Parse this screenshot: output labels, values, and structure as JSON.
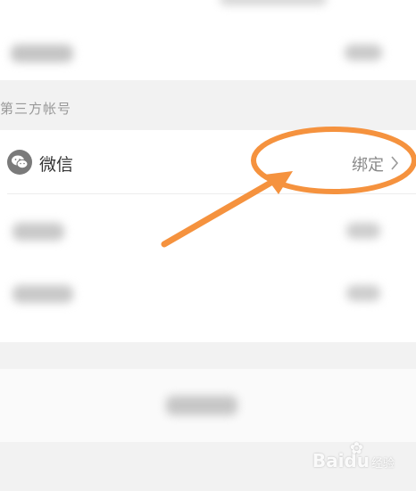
{
  "section": {
    "third_party_accounts": "第三方帐号"
  },
  "wechat_row": {
    "icon": "wechat-icon",
    "label": "微信",
    "action": "绑定",
    "chevron": "chevron-right-icon"
  },
  "annotation": {
    "color": "#f5923e"
  },
  "watermark": {
    "text": "Baidu",
    "sub": "经验"
  }
}
